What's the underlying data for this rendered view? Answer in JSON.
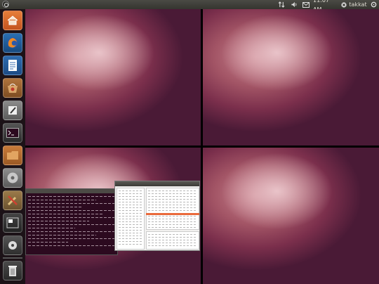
{
  "topbar": {
    "time": "11:07 AM",
    "user": "takkat",
    "indicators": [
      "network-icon",
      "volume-icon",
      "mail-icon",
      "user-icon"
    ]
  },
  "launcher": {
    "items": [
      {
        "icon": "home-folder-icon"
      },
      {
        "icon": "firefox-icon"
      },
      {
        "icon": "writer-document-icon"
      },
      {
        "icon": "software-center-icon"
      },
      {
        "icon": "text-editor-icon"
      },
      {
        "icon": "terminal-icon"
      },
      {
        "icon": "files-icon"
      },
      {
        "icon": "disk-icon"
      },
      {
        "icon": "system-settings-icon"
      },
      {
        "icon": "workspace-switcher-icon"
      },
      {
        "icon": "media-icon"
      },
      {
        "icon": "trash-icon"
      }
    ]
  },
  "workspaces": {
    "count": 4,
    "active": 3
  },
  "colors": {
    "panel": "#3c3b37",
    "accent": "#e96a3b",
    "launcher": "#1e1419"
  }
}
